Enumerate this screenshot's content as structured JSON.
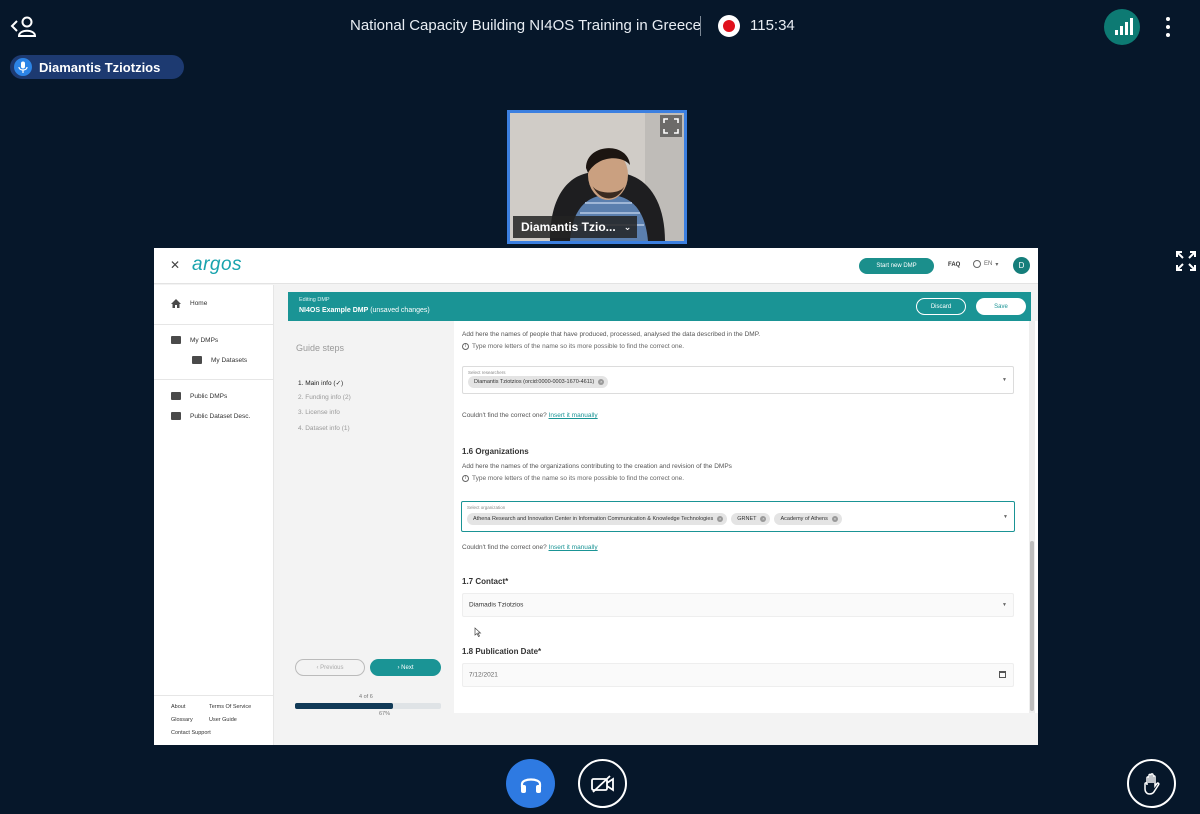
{
  "meeting": {
    "title": "National Capacity Building NI4OS Training in Greece",
    "recording_time": "115:34",
    "presenter_name": "Diamantis Tziotzios",
    "video_name": "Diamantis Tzio..."
  },
  "app": {
    "logo": "argos",
    "close_symbol": "✕",
    "header": {
      "start_new_dmp": "Start new DMP",
      "faq": "FAQ",
      "language": "EN",
      "avatar_initial": "D"
    },
    "sidebar": {
      "home": "Home",
      "my_dmps": "My DMPs",
      "my_datasets": "My Datasets",
      "public_dmps": "Public DMPs",
      "public_dataset_desc": "Public Dataset Desc.",
      "footer": {
        "about": "About",
        "terms": "Terms Of Service",
        "glossary": "Glossary",
        "user_guide": "User Guide",
        "contact": "Contact Support"
      }
    },
    "editing_bar": {
      "small": "Editing DMP",
      "title_bold": "NI4OS Example DMP",
      "title_rest": " (unsaved changes)",
      "discard": "Discard",
      "save": "Save"
    },
    "guide": {
      "title": "Guide steps",
      "steps": [
        "1. Main info (✓)",
        "2. Funding info (2)",
        "3. License info",
        "4. Dataset info (1)"
      ],
      "previous": "‹  Previous",
      "next": "›  Next",
      "progress_label": "4 of 6",
      "progress_pct": "67%",
      "progress_fraction": 0.67
    },
    "form": {
      "researchers_desc": "Add here the names of people that have produced, processed, analysed the data described in the DMP.",
      "researchers_hint": "Type more letters of the name so its more possible to find the correct one.",
      "researchers_field_label": "Select researchers",
      "researcher_chip": "Diamantis Tziotzios (orcid:0000-0003-1670-4611)",
      "not_found_1": "Couldn't find the correct one?",
      "insert_manually_1": "Insert it manually",
      "org_title": "1.6 Organizations",
      "org_desc": "Add here the names of the organizations contributing to the creation and revision of the DMPs",
      "org_hint": "Type more letters of the name so its more possible to find the correct one.",
      "org_field_label": "Select organization",
      "org_chips": [
        "Athena Research and Innovation Center in Information Communication & Knowledge Technologies",
        "GRNET",
        "Academy of Athens"
      ],
      "not_found_2": "Couldn't find the correct one?",
      "insert_manually_2": "Insert it manually",
      "contact_title": "1.7 Contact*",
      "contact_value": "Diamadis Tziotzios",
      "pubdate_title": "1.8 Publication Date*",
      "pubdate_value": "7/12/2021"
    }
  },
  "colors": {
    "accent": "#1a9495",
    "record": "#e0101b",
    "background": "#06172a",
    "presenter_tag": "#1d3a71",
    "audio_button": "#2e7ae2"
  }
}
